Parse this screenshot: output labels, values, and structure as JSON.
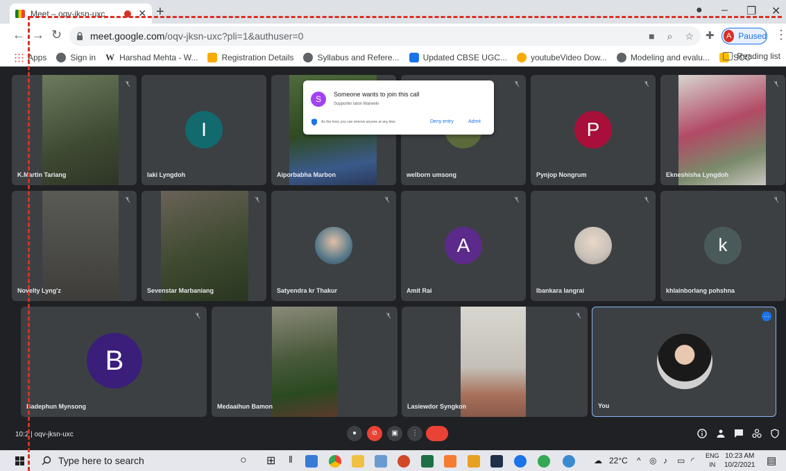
{
  "tab": {
    "title": "Meet – oqv-jksn-uxc"
  },
  "omnibox": {
    "host": "meet.google.com",
    "path": "/oqv-jksn-uxc?pli=1&authuser=0"
  },
  "profile": {
    "initial": "A",
    "status": "Paused"
  },
  "bookmarks": [
    {
      "label": "Apps",
      "color": "#ea4335"
    },
    {
      "label": "Sign in",
      "color": "#5f6368"
    },
    {
      "label": "Harshad Mehta - W...",
      "color": "#202124"
    },
    {
      "label": "Registration Details",
      "color": "#f9ab00"
    },
    {
      "label": "Syllabus and Refere...",
      "color": "#5f6368"
    },
    {
      "label": "Updated CBSE UGC...",
      "color": "#1a73e8"
    },
    {
      "label": "youtubeVideo Dow...",
      "color": "#f9ab00"
    },
    {
      "label": "Modeling and evalu...",
      "color": "#5f6368"
    },
    {
      "label": "SCC",
      "color": "#fbbc04"
    }
  ],
  "reading_list": "Reading list",
  "popup": {
    "initial": "S",
    "title": "Someone wants to join this call",
    "subtitle": "Supporter laton Marwein",
    "note": "As the host, you can remove anyone at any time",
    "deny": "Deny entry",
    "admit": "Admit"
  },
  "participants": {
    "p1": "K.Martin Tariang",
    "p2": "Iaki Lyngdoh",
    "p3": "Aiporbabha Marbon",
    "p4": "welborn umsong",
    "p5": "Pynjop Nongrum",
    "p6": "Ekneshisha Lyngdoh",
    "p7": "Novelty Lyng'z",
    "p8": "Sevenstar Marbaniang",
    "p9": "Satyendra kr Thakur",
    "p10": "Amit Rai",
    "p11": "Ibankara langrai",
    "p12": "khlainborlang pohshna",
    "p13": "Badephun Mynsong",
    "p14": "Medaaihun Bamon",
    "p15": "Lasiewdor Syngkon",
    "p16": "You"
  },
  "avatars": {
    "iaki": "I",
    "pynjop": "P",
    "amit": "A",
    "khlain": "k",
    "badephun": "B"
  },
  "meeting": {
    "time": "10:2",
    "code": "oqv-jksn-uxc"
  },
  "taskbar": {
    "search_placeholder": "Type here to search",
    "temperature": "22°C",
    "lang_top": "ENG",
    "lang_bottom": "IN",
    "time": "10:23 AM",
    "date": "10/2/2021"
  }
}
